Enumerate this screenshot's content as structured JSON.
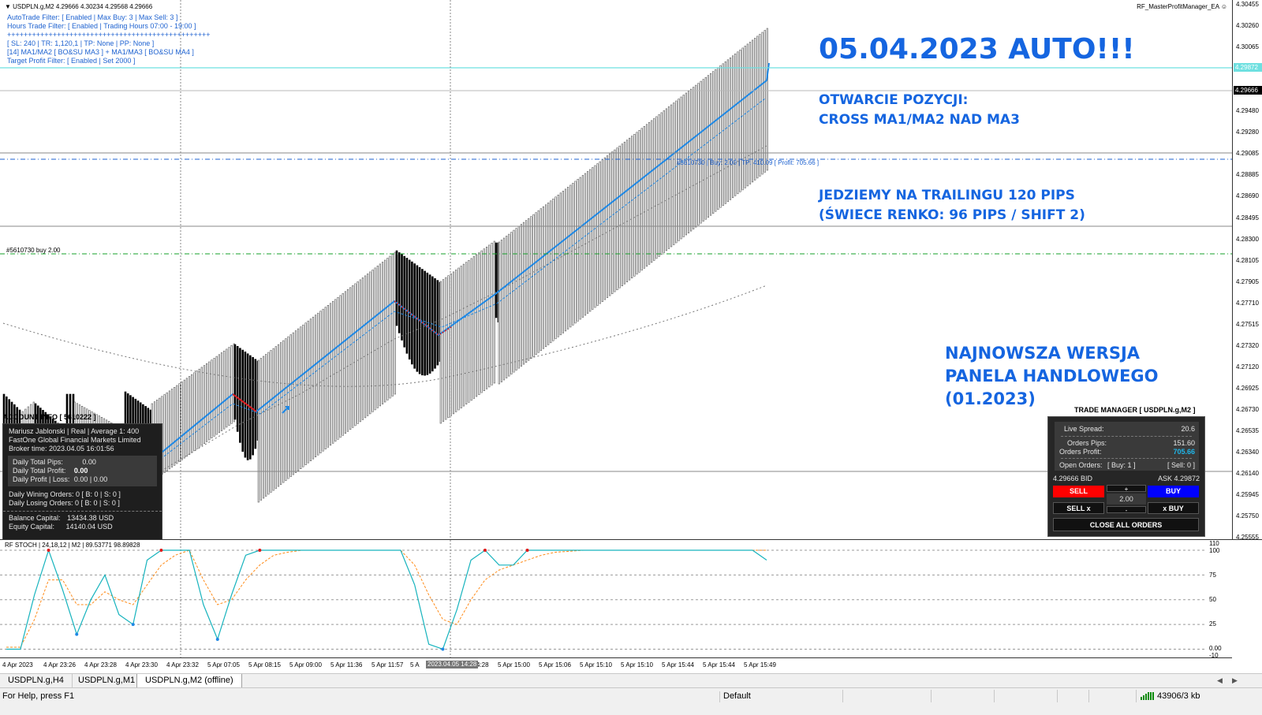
{
  "chart": {
    "header": "USDPLN.g,M2  4.29666 4.30234 4.29568 4.29666",
    "ea_name": "RF_MasterProfitManager_EA"
  },
  "ea_info": [
    "AutoTrade Filter: [ Enabled | Max Buy: 3 | Max Sell: 3 ]",
    "Hours Trade Filter: [ Enabled | Trading Hours 07:00 - 19:00 ]",
    "+++++++++++++++++++++++++++++++++++++++++++++++++",
    "[ SL: 240 | TR: 1,120,1 | TP: None | PP: None ]",
    "[14] MA1/MA2 [ BO&SU MA3 ] + MA1/MA3 [ BO&SU MA4 ]",
    "Target Profit Filter: [ Enabled | Set 2000 ]"
  ],
  "overlay": {
    "date_title": "05.04.2023 AUTO!!!",
    "open_line1": "OTWARCIE POZYCJI:",
    "open_line2": "CROSS MA1/MA2 NAD MA3",
    "trail_line1": "JEDZIEMY NA TRAILINGU 120 PIPS",
    "trail_line2": "(ŚWIECE RENKO: 96 PIPS / SHIFT 2)",
    "new_line1": "NAJNOWSZA WERSJA",
    "new_line2": "PANELA HANDLOWEGO",
    "new_line3": "(01.2023)"
  },
  "order_line_label": "#5610730 | Buy: 2.00 | TP: 410.09 [ Profit: 705.66 ]",
  "order_entry_label": "#5610730 buy 2.00",
  "price_axis": {
    "ticks": [
      "4.30455",
      "4.30260",
      "4.30065",
      "4.29870",
      "4.29675",
      "4.29480",
      "4.29280",
      "4.29085",
      "4.28885",
      "4.28690",
      "4.28495",
      "4.28300",
      "4.28105",
      "4.27905",
      "4.27710",
      "4.27515",
      "4.27320",
      "4.27120",
      "4.26925",
      "4.26730",
      "4.26535",
      "4.26340",
      "4.26140",
      "4.25945",
      "4.25750",
      "4.25555"
    ],
    "ask_label": "4.29872",
    "bid_label": "4.29666"
  },
  "account": {
    "title": "ACCOUNT INFO [ 5610222 ]",
    "name_line": "Mariusz Jablonski | Real | Average 1: 400",
    "broker": "FastOne Global Financial Markets Limited",
    "broker_time": "Broker time: 2023.04.05 16:01:56",
    "daily_pips_label": "Daily Total Pips:",
    "daily_pips": "0.00",
    "daily_profit_label": "Daily Total Profit:",
    "daily_profit": "0.00",
    "daily_pl_label": "Daily Profit | Loss:",
    "daily_pl": "0.00 | 0.00",
    "win_orders": "Daily Wining Orders:   0    [ B: 0 | S: 0 ]",
    "lose_orders": "Daily Losing Orders:   0    [ B: 0 | S: 0 ]",
    "balance_label": "Balance Capital:",
    "balance": "13434.38 USD",
    "equity_label": "Equity Capital:",
    "equity": "14140.04 USD"
  },
  "trade_manager": {
    "title": "TRADE MANAGER [ USDPLN.g,M2 ]",
    "spread_label": "Live Spread:",
    "spread": "20.6",
    "pips_label": "Orders Pips:",
    "pips": "151.60",
    "profit_label": "Orders Profit:",
    "profit": "705.66",
    "open_orders_label": "Open Orders:",
    "open_buy": "[ Buy: 1 ]",
    "open_sell": "[ Sell: 0 ]",
    "bid": "4.29666 BID",
    "ask": "ASK 4.29872",
    "sell": "SELL",
    "buy": "BUY",
    "plus": "+",
    "minus": "-",
    "lot": "2.00",
    "sell_x": "SELL x",
    "buy_x": "x BUY",
    "close_all": "CLOSE ALL ORDERS",
    "colors": {
      "sell": "#ff0000",
      "buy": "#0000ff",
      "profit": "#1fb5e8"
    }
  },
  "stoch": {
    "title": "RF STOCH | 24,18,12 | M2 | 89.53771 98.89828",
    "ticks": [
      "110",
      "100",
      "75",
      "50",
      "25",
      "0.00",
      "-10"
    ],
    "main_values": [
      0,
      0,
      55,
      100,
      60,
      15,
      50,
      75,
      35,
      25,
      90,
      100,
      100,
      100,
      45,
      10,
      55,
      95,
      100,
      100,
      100,
      100,
      100,
      100,
      100,
      100,
      100,
      100,
      100,
      65,
      5,
      0,
      40,
      90,
      100,
      85,
      85,
      100,
      100,
      100,
      100,
      100,
      100,
      100,
      100,
      100,
      100,
      100,
      100,
      100,
      100,
      100,
      100,
      100,
      90
    ],
    "signal_values": [
      2,
      2,
      30,
      70,
      70,
      45,
      45,
      58,
      50,
      45,
      65,
      85,
      95,
      100,
      70,
      45,
      50,
      70,
      85,
      95,
      98,
      100,
      100,
      100,
      100,
      100,
      100,
      100,
      100,
      85,
      55,
      30,
      25,
      50,
      70,
      80,
      85,
      90,
      95,
      98,
      99,
      100,
      100,
      100,
      100,
      100,
      100,
      100,
      100,
      100,
      100,
      100,
      100,
      100,
      100
    ],
    "colors": {
      "main": "#16b3bd",
      "signal": "#ff8c1a"
    }
  },
  "time_axis": {
    "ticks": [
      "4 Apr 2023",
      "4 Apr 23:26",
      "4 Apr 23:28",
      "4 Apr 23:30",
      "4 Apr 23:32",
      "5 Apr 07:05",
      "5 Apr 08:15",
      "5 Apr 09:00",
      "5 Apr 11:36",
      "5 Apr 11:57",
      "5 A",
      "4:28",
      "5 Apr 15:00",
      "5 Apr 15:06",
      "5 Apr 15:10",
      "5 Apr 15:10",
      "5 Apr 15:44",
      "5 Apr 15:44",
      "5 Apr 15:49"
    ],
    "cursor": "2023.04.05 14:28"
  },
  "tabs": [
    "USDPLN.g,H4",
    "USDPLN.g,M1",
    "USDPLN.g,M2 (offline)"
  ],
  "status": {
    "help": "For Help, press F1",
    "profile": "Default",
    "traffic": "43906/3 kb"
  },
  "colors": {
    "accent": "#1565e0",
    "ma_line": "#1e88e5",
    "order_line": "#1e62d0",
    "entry_line": "#16a02a",
    "cyan_line": "#6ee0e0"
  }
}
